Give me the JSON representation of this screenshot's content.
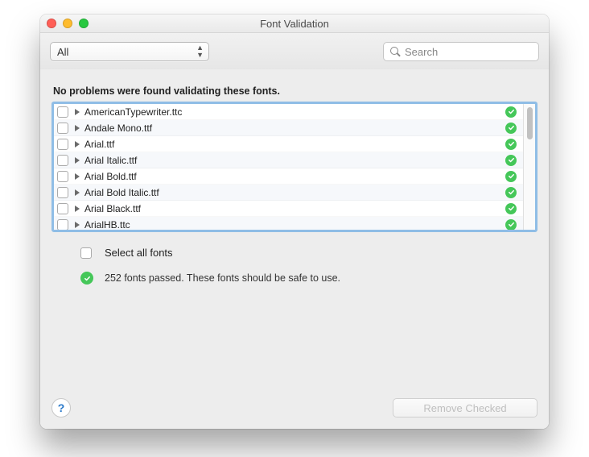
{
  "window": {
    "title": "Font Validation"
  },
  "toolbar": {
    "filter_label": "All",
    "search_placeholder": "Search"
  },
  "heading": "No problems were found validating these fonts.",
  "fonts": [
    {
      "name": "AmericanTypewriter.ttc",
      "checked": false,
      "passed": true
    },
    {
      "name": "Andale Mono.ttf",
      "checked": false,
      "passed": true
    },
    {
      "name": "Arial.ttf",
      "checked": false,
      "passed": true
    },
    {
      "name": "Arial Italic.ttf",
      "checked": false,
      "passed": true
    },
    {
      "name": "Arial Bold.ttf",
      "checked": false,
      "passed": true
    },
    {
      "name": "Arial Bold Italic.ttf",
      "checked": false,
      "passed": true
    },
    {
      "name": "Arial Black.ttf",
      "checked": false,
      "passed": true
    },
    {
      "name": "ArialHB.ttc",
      "checked": false,
      "passed": true
    }
  ],
  "select_all_label": "Select all fonts",
  "status_text": "252 fonts passed. These fonts should be safe to use.",
  "remove_button_label": "Remove Checked",
  "colors": {
    "focus_ring": "#8fbde6",
    "pass_green": "#45c759"
  }
}
